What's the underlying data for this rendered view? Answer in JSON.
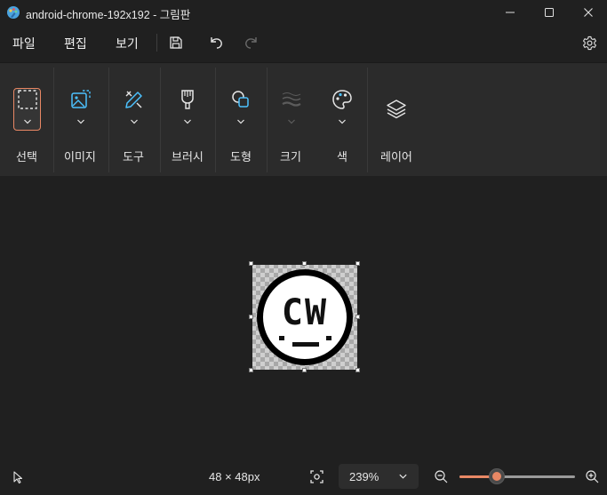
{
  "window": {
    "title": "android-chrome-192x192 - 그림판",
    "minimize_icon": "minimize-icon",
    "maximize_icon": "maximize-icon",
    "close_icon": "close-icon"
  },
  "menubar": {
    "file": "파일",
    "edit": "편집",
    "view": "보기"
  },
  "ribbon": {
    "tools": [
      {
        "label": "선택",
        "icon": "selection-icon",
        "selected": true
      },
      {
        "label": "이미지",
        "icon": "image-icon"
      },
      {
        "label": "도구",
        "icon": "tools-icon"
      },
      {
        "label": "브러시",
        "icon": "brush-icon"
      },
      {
        "label": "도형",
        "icon": "shapes-icon"
      },
      {
        "label": "크기",
        "icon": "size-icon",
        "disabled": true
      },
      {
        "label": "색",
        "icon": "palette-icon"
      },
      {
        "label": "레이어",
        "icon": "layers-icon"
      }
    ]
  },
  "canvas": {
    "image_text": "CW"
  },
  "status": {
    "dimensions": "48 × 48px",
    "zoom": "239%",
    "zoom_fraction": 0.32
  },
  "colors": {
    "accent": "#e98865",
    "background": "#202020",
    "ribbon": "#2b2b2b"
  }
}
